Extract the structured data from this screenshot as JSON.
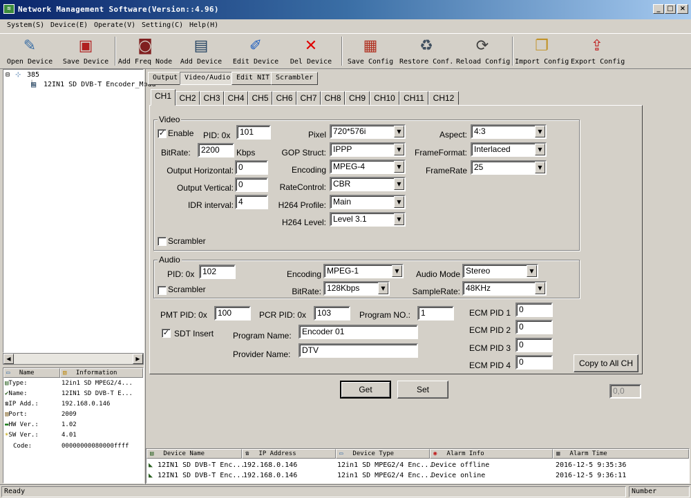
{
  "window": {
    "title": "Network Management Software(Version::4.96)",
    "minimize": "_",
    "restore": "□",
    "close": "×"
  },
  "menu": [
    "System(S)",
    "Device(E)",
    "Operate(V)",
    "Setting(C)",
    "Help(H)"
  ],
  "toolbar": {
    "open_device": "Open Device",
    "save_device": "Save Device",
    "add_freq_node": "Add Freq Node",
    "add_device": "Add Device",
    "edit_device": "Edit Device",
    "del_device": "Del Device",
    "save_config": "Save Config",
    "restore_conf": "Restore Conf.",
    "reload_config": "Reload Config",
    "import_config": "Import Config",
    "export_config": "Export Config"
  },
  "tree": {
    "root": "385",
    "child": "12IN1 SD DVB-T Encoder_Modu"
  },
  "info": {
    "header_name": "Name",
    "header_info": "Information",
    "rows": [
      {
        "name": "Type:",
        "value": "12in1 SD MPEG2/4..."
      },
      {
        "name": "Name:",
        "value": "12IN1 SD DVB-T E..."
      },
      {
        "name": "IP Add.:",
        "value": "192.168.0.146"
      },
      {
        "name": "Port:",
        "value": "2009"
      },
      {
        "name": "HW Ver.:",
        "value": "1.02"
      },
      {
        "name": "SW Ver.:",
        "value": "4.01"
      },
      {
        "name": "Code:",
        "value": "00000000080000ffff"
      }
    ]
  },
  "top_tabs": [
    "Output",
    "Video/Audio",
    "Edit NIT",
    "Scrambler"
  ],
  "channels": [
    "CH1",
    "CH2",
    "CH3",
    "CH4",
    "CH5",
    "CH6",
    "CH7",
    "CH8",
    "CH9",
    "CH10",
    "CH11",
    "CH12"
  ],
  "video": {
    "group": "Video",
    "enable_label": "Enable",
    "enable_checked": "✓",
    "pid_label": "PID: 0x",
    "pid": "101",
    "bitrate_label": "BitRate:",
    "bitrate": "2200",
    "bitrate_unit": "Kbps",
    "out_h_label": "Output Horizontal:",
    "out_h": "0",
    "out_v_label": "Output Vertical:",
    "out_v": "0",
    "idr_label": "IDR interval:",
    "idr": "4",
    "pixel_label": "Pixel",
    "pixel": "720*576i",
    "gop_label": "GOP Struct:",
    "gop": "IPPP",
    "encoding_label": "Encoding",
    "encoding": "MPEG-4",
    "ratecontrol_label": "RateControl:",
    "ratecontrol": "CBR",
    "profile_label": "H264 Profile:",
    "profile": "Main",
    "level_label": "H264 Level:",
    "level": "Level 3.1",
    "aspect_label": "Aspect:",
    "aspect": "4:3",
    "frameformat_label": "FrameFormat:",
    "frameformat": "Interlaced",
    "framerate_label": "FrameRate",
    "framerate": "25",
    "scrambler_label": "Scrambler"
  },
  "audio": {
    "group": "Audio",
    "pid_label": "PID: 0x",
    "pid": "102",
    "scrambler_label": "Scrambler",
    "encoding_label": "Encoding",
    "encoding": "MPEG-1",
    "bitrate_label": "BitRate:",
    "bitrate": "128Kbps",
    "mode_label": "Audio Mode",
    "mode": "Stereo",
    "samplerate_label": "SampleRate:",
    "samplerate": "48KHz"
  },
  "program": {
    "pmt_label": "PMT PID: 0x",
    "pmt": "100",
    "pcr_label": "PCR PID: 0x",
    "pcr": "103",
    "progno_label": "Program NO.:",
    "progno": "1",
    "sdt_label": "SDT Insert",
    "sdt_checked": "✓",
    "progname_label": "Program Name:",
    "progname": "Encoder 01",
    "provider_label": "Provider Name:",
    "provider": "DTV",
    "ecm1_label": "ECM PID 1",
    "ecm1": "0",
    "ecm2_label": "ECM PID 2",
    "ecm2": "0",
    "ecm3_label": "ECM PID 3",
    "ecm3": "0",
    "ecm4_label": "ECM PID 4",
    "ecm4": "0",
    "copy_all": "Copy to All CH"
  },
  "actions": {
    "get": "Get",
    "set": "Set",
    "coord": "0,0"
  },
  "log": {
    "headers": [
      "Device Name",
      "IP Address",
      "Device Type",
      "Alarm Info",
      "Alarm Time"
    ],
    "rows": [
      [
        "12IN1 SD DVB-T Enc...",
        "192.168.0.146",
        "12in1 SD MPEG2/4 Enc...",
        "Device offline",
        "2016-12-5 9:35:36"
      ],
      [
        "12IN1 SD DVB-T Enc...",
        "192.168.0.146",
        "12in1 SD MPEG2/4 Enc...",
        "Device online",
        "2016-12-5 9:36:11"
      ]
    ]
  },
  "status": {
    "left": "Ready",
    "right": "Number"
  }
}
